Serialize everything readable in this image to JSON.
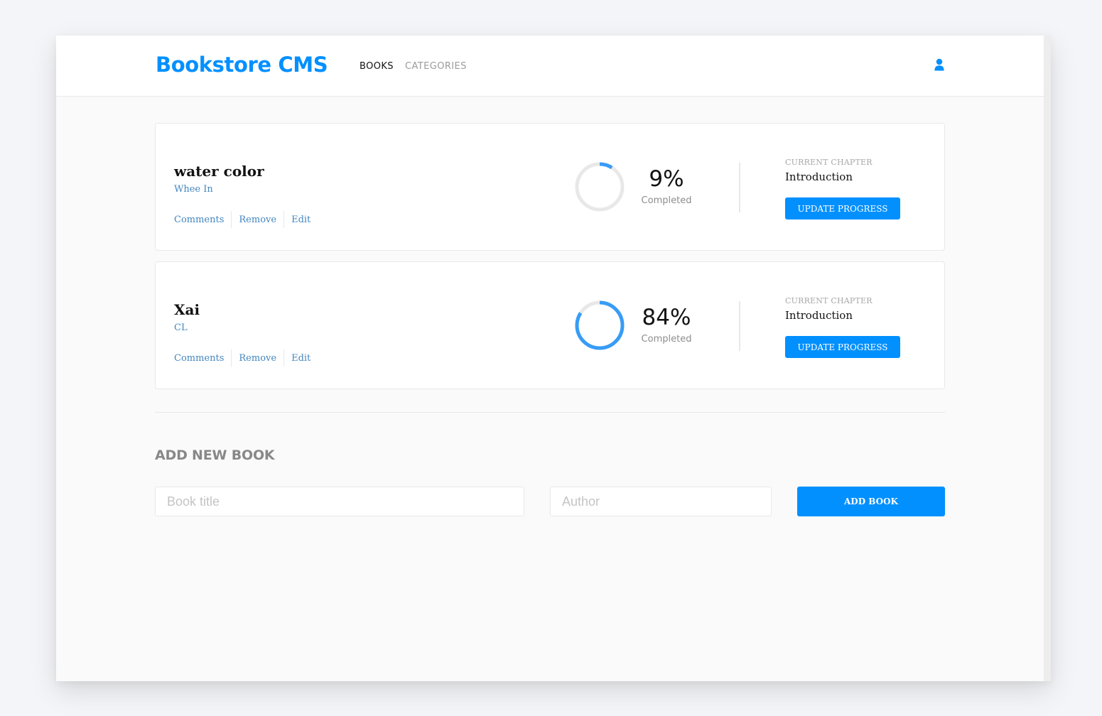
{
  "app": {
    "title": "Bookstore CMS"
  },
  "nav": {
    "books_label": "BOOKS",
    "categories_label": "CATEGORIES",
    "active": "BOOKS"
  },
  "header": {
    "user_icon": "user-icon"
  },
  "books": [
    {
      "title": "water color",
      "author": "Whee In",
      "actions": {
        "comments": "Comments",
        "remove": "Remove",
        "edit": "Edit"
      },
      "progress": 9,
      "percent_label": "9%",
      "completed_label": "Completed",
      "chapter_label": "CURRENT CHAPTER",
      "chapter": "Introduction",
      "update_label": "UPDATE PROGRESS"
    },
    {
      "title": "Xai",
      "author": "CL",
      "actions": {
        "comments": "Comments",
        "remove": "Remove",
        "edit": "Edit"
      },
      "progress": 84,
      "percent_label": "84%",
      "completed_label": "Completed",
      "chapter_label": "CURRENT CHAPTER",
      "chapter": "Introduction",
      "update_label": "UPDATE PROGRESS"
    }
  ],
  "add_form": {
    "heading": "ADD NEW BOOK",
    "title_placeholder": "Book title",
    "title_value": "",
    "author_placeholder": "Author",
    "author_value": "",
    "submit_label": "ADD BOOK"
  },
  "colors": {
    "accent": "#0290ff",
    "progress_arc": "#379cf6",
    "progress_track": "#e8e8e8",
    "link": "#4386bf",
    "background": "#fafafa"
  }
}
